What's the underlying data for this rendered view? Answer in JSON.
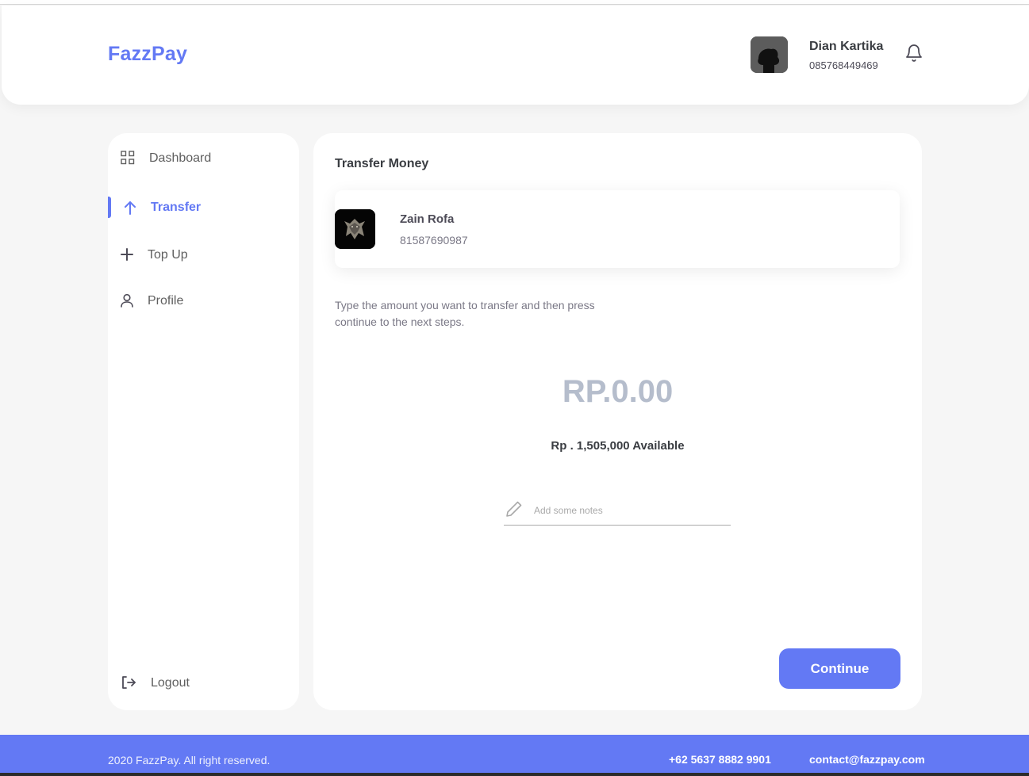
{
  "brand": {
    "name": "FazzPay"
  },
  "user": {
    "name": "Dian Kartika",
    "phone": "085768449469"
  },
  "sidebar": {
    "items": [
      {
        "label": "Dashboard",
        "icon": "grid-icon"
      },
      {
        "label": "Transfer",
        "icon": "arrow-up-icon",
        "active": true
      },
      {
        "label": "Top Up",
        "icon": "plus-icon"
      },
      {
        "label": "Profile",
        "icon": "user-icon"
      }
    ],
    "logout": {
      "label": "Logout",
      "icon": "logout-icon"
    }
  },
  "main": {
    "title": "Transfer Money",
    "receiver": {
      "name": "Zain Rofa",
      "phone": "81587690987"
    },
    "instruction": "Type the amount you want to transfer and then press continue to the next steps.",
    "amount": "RP.0.00",
    "available": "Rp . 1,505,000 Available",
    "notes_placeholder": "Add some notes",
    "continue_label": "Continue"
  },
  "footer": {
    "copyright": "2020 FazzPay. All right reserved.",
    "phone": "+62 5637 8882 9901",
    "email": "contact@fazzpay.com"
  },
  "colors": {
    "accent": "#6379F4",
    "amount": "#B5BDCC",
    "background": "#f6f6f6"
  }
}
